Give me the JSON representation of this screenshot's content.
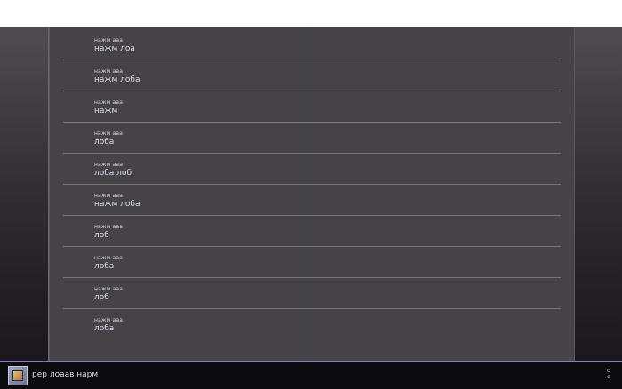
{
  "list": {
    "rows": [
      {
        "kicker": "нажм ааа",
        "value": "нажм лоа"
      },
      {
        "kicker": "нажм ааа",
        "value": "нажм лоба"
      },
      {
        "kicker": "нажм ааа",
        "value": "нажм"
      },
      {
        "kicker": "нажм ааа",
        "value": "лоба"
      },
      {
        "kicker": "нажм ааа",
        "value": "лоба лоб"
      },
      {
        "kicker": "нажм ааа",
        "value": "нажм лоба"
      },
      {
        "kicker": "нажм ааа",
        "value": "лоб"
      },
      {
        "kicker": "нажм ааа",
        "value": "лоба"
      },
      {
        "kicker": "нажм ааа",
        "value": "лоб"
      },
      {
        "kicker": "нажм ааа",
        "value": "лоба"
      }
    ]
  },
  "taskbar": {
    "title": "рер лоаав нарм",
    "icon": "app-icon",
    "right_glyphs": [
      "о",
      "о"
    ]
  }
}
